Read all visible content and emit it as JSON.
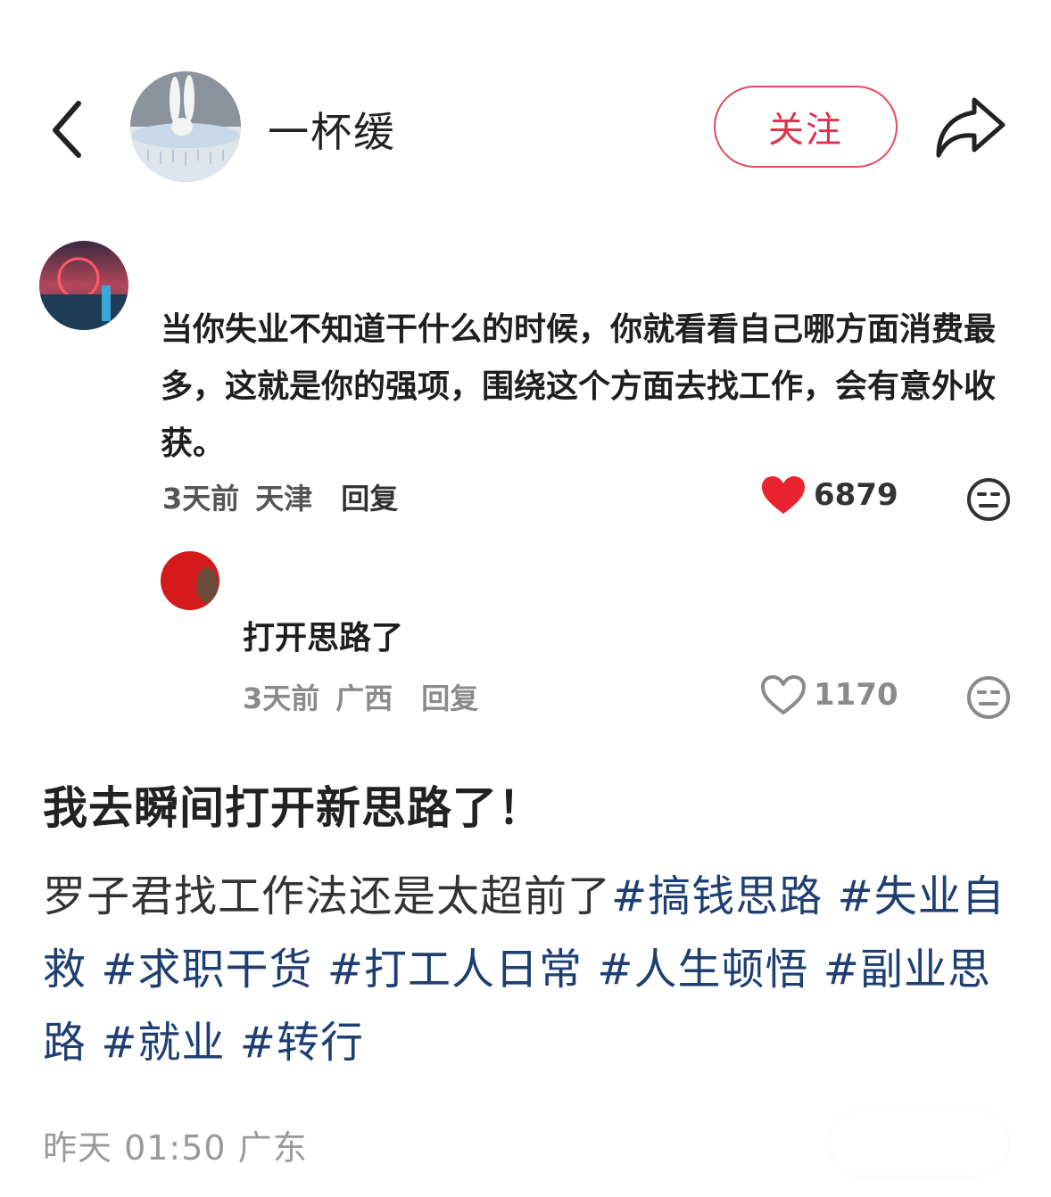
{
  "header": {
    "username": "一杯缓",
    "follow_label": "关注"
  },
  "comment_card": {
    "comment1": {
      "text": "当你失业不知道干什么的时候，你就看看自己哪方面消费最多，这就是你的强项，围绕这个方面去找工作，会有意外收获。",
      "time": "3天前",
      "location": "天津",
      "reply": "回复",
      "likes": "6879",
      "liked": true
    },
    "comment2": {
      "text": "打开思路了",
      "time": "3天前",
      "location": "广西",
      "reply": "回复",
      "likes": "1170",
      "liked": false
    }
  },
  "post": {
    "title": "我去瞬间打开新思路了！",
    "body": "罗子君找工作法还是太超前了",
    "tags": [
      "#搞钱思路",
      "#失业自救",
      "#求职干货",
      "#打工人日常",
      "#人生顿悟",
      "#副业思路",
      "#就业",
      "#转行"
    ],
    "time": "昨天 01:50",
    "location": "广东"
  },
  "colors": {
    "follow": "#e0334b",
    "tag": "#1e3f72",
    "heart": "#e8222f"
  },
  "icons": [
    "back-arrow-icon",
    "share-icon",
    "heart-icon",
    "emoji-face-icon"
  ]
}
